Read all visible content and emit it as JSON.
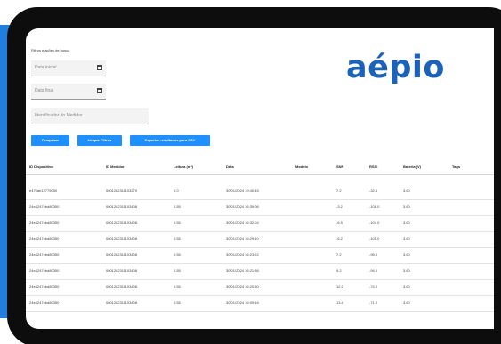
{
  "brand": {
    "logo_text": "aépio",
    "logo_color": "#1b63b8",
    "accent_color": "#1e90ff"
  },
  "filters": {
    "title": "Filtros e ações de busca",
    "start_date_placeholder": "Data inicial",
    "end_date_placeholder": "Data final",
    "meter_id_placeholder": "Identificador do Medidor"
  },
  "buttons": {
    "search": "Pesquisar",
    "clear": "Limpar Filtros",
    "export": "Exportar resultados para CSV"
  },
  "table": {
    "columns": [
      "ID Dispositivo",
      "ID Medidor",
      "Leitura (m³)",
      "Data",
      "Modelo",
      "SNR",
      "RSSI",
      "Bateria (V)",
      "Tags"
    ],
    "rows": [
      [
        "e470ab12779050",
        "0001282311103279",
        "0.0",
        "30/01/2024 19:40:45",
        "",
        "7.2",
        "-32.0",
        "3.60",
        ""
      ],
      [
        "24e4247ebd80350",
        "0001282311103408",
        "0.55",
        "30/01/2024 16:39:06",
        "",
        "-3.2",
        "-106.0",
        "3.60",
        ""
      ],
      [
        "24e4247ebd80350",
        "0001282311103408",
        "0.55",
        "30/01/2024 16:32:04",
        "",
        "-6.5",
        "-104.0",
        "3.60",
        ""
      ],
      [
        "24e4247ebd80350",
        "0001282311103408",
        "0.55",
        "30/01/2024 16:29:10",
        "",
        "-6.2",
        "-105.0",
        "3.60",
        ""
      ],
      [
        "24e4247ebd80350",
        "0001282311103408",
        "0.55",
        "30/01/2024 16:23:22",
        "",
        "7.2",
        "-95.0",
        "3.60",
        ""
      ],
      [
        "24e4247ebd80350",
        "0001282311103408",
        "0.55",
        "30/01/2024 16:21:36",
        "",
        "9.2",
        "-94.0",
        "3.60",
        ""
      ],
      [
        "24e4247ebd80350",
        "0001282311103408",
        "0.55",
        "30/01/2024 16:20:50",
        "",
        "12.2",
        "-74.0",
        "3.60",
        ""
      ],
      [
        "24e4247ebd80350",
        "0001282311103408",
        "0.55",
        "30/01/2024 16:09:16",
        "",
        "13.4",
        "-71.0",
        "3.60",
        ""
      ]
    ]
  }
}
